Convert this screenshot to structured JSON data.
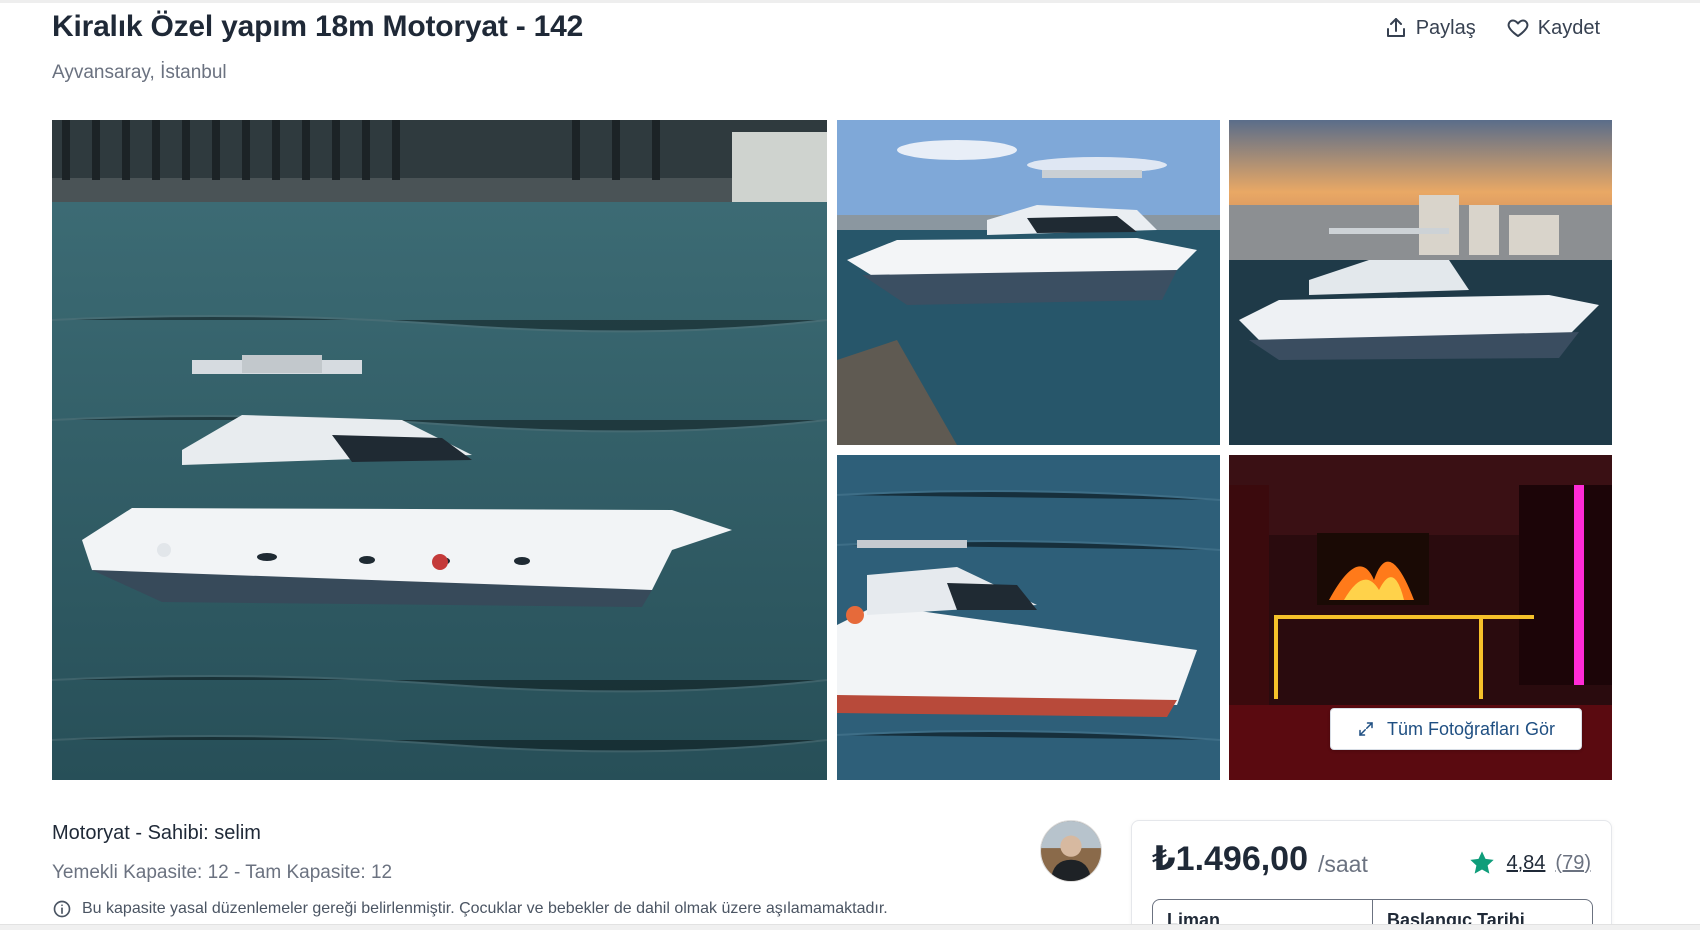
{
  "listing": {
    "title": "Kiralık Özel yapım 18m Motoryat - 142",
    "location": "Ayvansaray, İstanbul"
  },
  "actions": {
    "share_label": "Paylaş",
    "save_label": "Kaydet"
  },
  "gallery": {
    "view_all_label": "Tüm Fotoğrafları Gör"
  },
  "details": {
    "type_owner": "Motoryat - Sahibi: selim",
    "capacity": "Yemekli Kapasite: 12 - Tam Kapasite: 12",
    "capacity_notice": "Bu kapasite yasal düzenlemeler gereği belirlenmiştir. Çocuklar ve bebekler de dahil olmak üzere aşılamamaktadır."
  },
  "booking": {
    "price": "₺1.496,00",
    "unit": "/saat",
    "rating": "4,84",
    "review_count": "(79)",
    "port_label": "Liman",
    "start_date_label": "Başlangıç Tarihi"
  },
  "icons": {
    "share": "share-icon",
    "save": "heart-icon",
    "expand": "expand-icon",
    "info": "info-icon",
    "star": "star-icon"
  },
  "colors": {
    "star": "#0f9d7a",
    "link": "#1f4f82",
    "title": "#1f2937",
    "muted": "#6b7280"
  }
}
